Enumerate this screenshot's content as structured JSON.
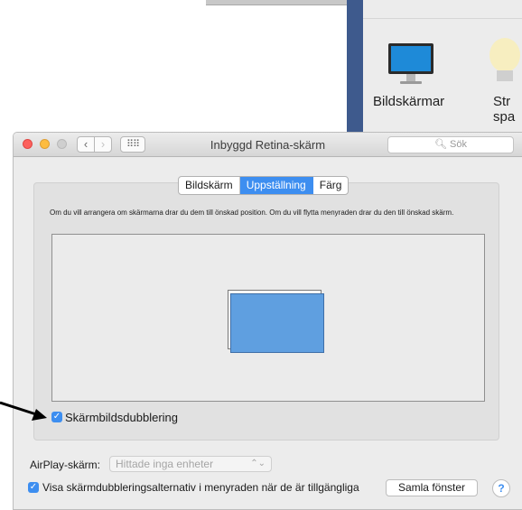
{
  "background_pane": {
    "items": [
      {
        "label": "Bildskärmar",
        "icon": "display-icon"
      },
      {
        "label_line1": "Str",
        "label_line2": "spa",
        "icon": "lightbulb-icon"
      }
    ]
  },
  "window": {
    "title": "Inbyggd Retina-skärm",
    "search_placeholder": "Sök",
    "nav_back": "‹",
    "nav_forward": "›",
    "nav_grid": "⠿⠿"
  },
  "tabs": [
    {
      "label": "Bildskärm",
      "active": false
    },
    {
      "label": "Uppställning",
      "active": true
    },
    {
      "label": "Färg",
      "active": false
    }
  ],
  "arrangement": {
    "instructions": "Om du vill arrangera om skärmarna drar du dem till önskad position. Om du vill flytta menyraden drar du den till önskad skärm.",
    "mirroring_label": "Skärmbildsdubblering",
    "mirroring_checked": true
  },
  "airplay": {
    "label": "AirPlay-skärm:",
    "selected": "Hittade inga enheter"
  },
  "footer": {
    "show_in_menubar_label": "Visa skärmdubbleringsalternativ i menyraden när de är tillgängliga",
    "show_in_menubar_checked": true,
    "gather_windows_button": "Samla fönster",
    "help_button": "?"
  },
  "colors": {
    "accent": "#3d8ef0",
    "display_blue": "#5f9fe0",
    "sidebar_blue": "#3e5a8d"
  }
}
